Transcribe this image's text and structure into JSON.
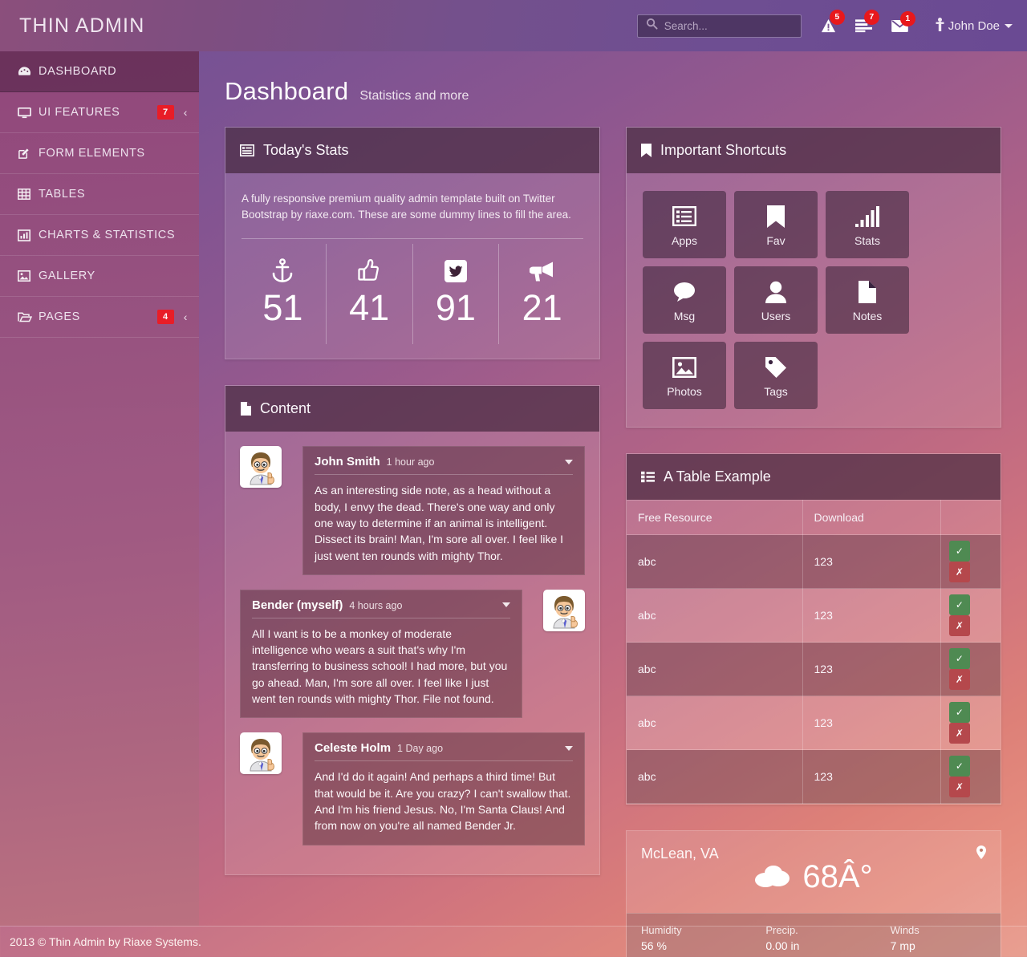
{
  "header": {
    "brand": "THIN ADMIN",
    "search": {
      "placeholder": "Search...",
      "value": ""
    },
    "notifications": [
      {
        "icon": "warning-icon",
        "count": "5"
      },
      {
        "icon": "tasks-icon",
        "count": "7"
      },
      {
        "icon": "envelope-icon",
        "count": "1"
      }
    ],
    "user": "John Doe"
  },
  "sidebar": {
    "items": [
      {
        "label": "DASHBOARD",
        "icon": "dashboard-icon",
        "active": true,
        "badge": "",
        "arrow": ""
      },
      {
        "label": "UI FEATURES",
        "icon": "monitor-icon",
        "active": false,
        "badge": "7",
        "arrow": "‹"
      },
      {
        "label": "FORM ELEMENTS",
        "icon": "edit-icon",
        "active": false,
        "badge": "",
        "arrow": ""
      },
      {
        "label": "TABLES",
        "icon": "table-icon",
        "active": false,
        "badge": "",
        "arrow": ""
      },
      {
        "label": "CHARTS & STATISTICS",
        "icon": "bar-chart-icon",
        "active": false,
        "badge": "",
        "arrow": ""
      },
      {
        "label": "GALLERY",
        "icon": "image-icon",
        "active": false,
        "badge": "",
        "arrow": ""
      },
      {
        "label": "PAGES",
        "icon": "folder-icon",
        "active": false,
        "badge": "4",
        "arrow": "‹"
      }
    ]
  },
  "page": {
    "title": "Dashboard",
    "subtitle": "Statistics and more"
  },
  "todays_stats": {
    "title": "Today's Stats",
    "icon": "list-alt-icon",
    "description": "A fully responsive premium quality admin template built on Twitter Bootstrap by riaxe.com. These are some dummy lines to fill the area.",
    "stats": [
      {
        "icon": "anchor-icon",
        "value": "51"
      },
      {
        "icon": "thumbs-up-icon",
        "value": "41"
      },
      {
        "icon": "twitter-icon",
        "value": "91"
      },
      {
        "icon": "bullhorn-icon",
        "value": "21"
      }
    ]
  },
  "shortcuts": {
    "title": "Important Shortcuts",
    "icon": "bookmark-icon",
    "tiles": [
      {
        "label": "Apps",
        "icon": "apps-list-icon"
      },
      {
        "label": "Fav",
        "icon": "bookmark-icon"
      },
      {
        "label": "Stats",
        "icon": "signal-bars-icon"
      },
      {
        "label": "Msg",
        "icon": "comment-icon"
      },
      {
        "label": "Users",
        "icon": "user-icon"
      },
      {
        "label": "Notes",
        "icon": "file-icon"
      },
      {
        "label": "Photos",
        "icon": "photo-icon"
      },
      {
        "label": "Tags",
        "icon": "tag-icon"
      }
    ]
  },
  "content_panel": {
    "title": "Content",
    "icon": "file-icon",
    "messages": [
      {
        "name": "John Smith",
        "time": "1 hour ago",
        "text": "As an interesting side note, as a head without a body, I envy the dead. There's one way and only one way to determine if an animal is intelligent. Dissect its brain! Man, I'm sore all over. I feel like I just went ten rounds with mighty Thor.",
        "side": "left"
      },
      {
        "name": "Bender (myself)",
        "time": "4 hours ago",
        "text": "All I want is to be a monkey of moderate intelligence who wears a suit that's why I'm transferring to business school! I had more, but you go ahead. Man, I'm sore all over. I feel like I just went ten rounds with mighty Thor. File not found.",
        "side": "right"
      },
      {
        "name": "Celeste Holm",
        "time": "1 Day ago",
        "text": "And I'd do it again! And perhaps a third time! But that would be it. Are you crazy? I can't swallow that. And I'm his friend Jesus. No, I'm Santa Claus! And from now on you're all named Bender Jr.",
        "side": "left"
      }
    ]
  },
  "table_panel": {
    "title": "A Table Example",
    "icon": "list-icon",
    "columns": [
      "Free Resource",
      "Download",
      ""
    ],
    "rows": [
      {
        "resource": "abc",
        "download": "123"
      },
      {
        "resource": "abc",
        "download": "123"
      },
      {
        "resource": "abc",
        "download": "123"
      },
      {
        "resource": "abc",
        "download": "123"
      },
      {
        "resource": "abc",
        "download": "123"
      }
    ],
    "accept_icon": "check-icon",
    "reject_icon": "times-icon"
  },
  "weather": {
    "city": "McLean, VA",
    "pin_icon": "map-pin-icon",
    "condition_icon": "cloud-icon",
    "temperature": "68Â°",
    "details": [
      {
        "key": "Humidity",
        "value": "56 %"
      },
      {
        "key": "Precip.",
        "value": "0.00 in"
      },
      {
        "key": "Winds",
        "value": "7 mp"
      }
    ]
  },
  "footer": {
    "text": "2013 © Thin Admin by Riaxe Systems."
  },
  "colors": {
    "badge_red": "#ec1c24",
    "accept_green": "#4f8a52",
    "reject_red": "#b5484c",
    "panel_header": "#3e2237"
  }
}
